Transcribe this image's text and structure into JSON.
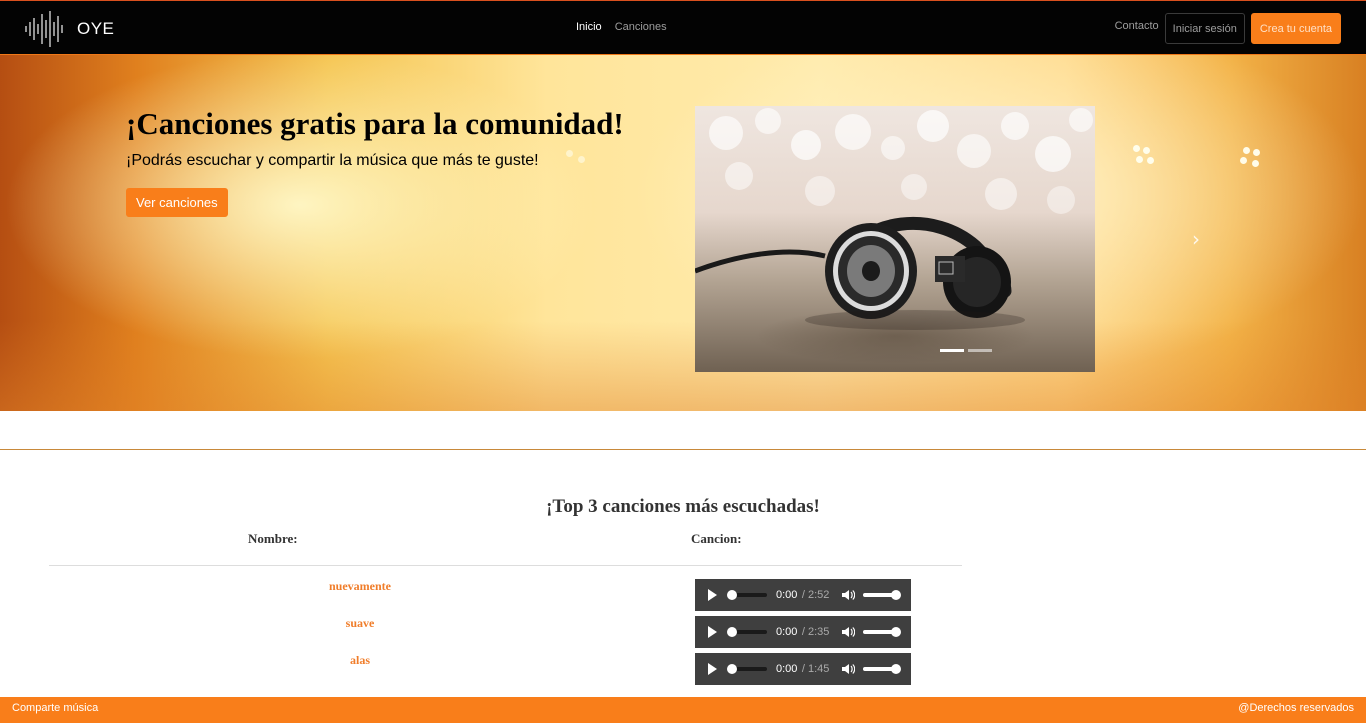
{
  "navbar": {
    "brand": "OYE",
    "links": [
      {
        "label": "Inicio",
        "active": true
      },
      {
        "label": "Canciones",
        "active": false
      }
    ],
    "contact_label": "Contacto",
    "login_label": "Iniciar sesión",
    "signup_label": "Crea tu cuenta"
  },
  "hero": {
    "title": "¡Canciones gratis para la comunidad!",
    "subtitle": "¡Podrás escuchar y compartir la música que más te guste!",
    "cta_label": "Ver canciones",
    "carousel": {
      "slides": 2,
      "active_slide": 1
    }
  },
  "top": {
    "title": "¡Top 3 canciones más escuchadas!",
    "col_name": "Nombre:",
    "col_song": "Cancion:",
    "songs": [
      {
        "name": "nuevamente",
        "current": "0:00",
        "duration": "/ 2:52"
      },
      {
        "name": "suave",
        "current": "0:00",
        "duration": "/ 2:35"
      },
      {
        "name": "alas",
        "current": "0:00",
        "duration": "/ 1:45"
      }
    ]
  },
  "footer": {
    "left": "Comparte música",
    "right": "@Derechos reservados"
  },
  "colors": {
    "accent": "#f97e1a",
    "navbar": "#030303",
    "song_link": "#f07d2a",
    "player_bg": "#3f3f3f"
  }
}
